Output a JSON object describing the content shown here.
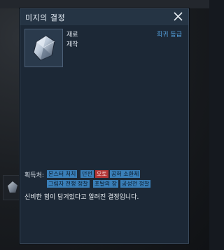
{
  "tooltip": {
    "title": "미지의 결정",
    "close_icon": "close-icon",
    "item_icon": "crystal-icon",
    "category1": "재료",
    "category2": "제작",
    "grade": "희귀 등급",
    "source_label": "획득처:",
    "sources": [
      "몬스터 처치",
      "던전",
      "오토",
      "공허 소환체",
      "그림자 전쟁 정찰",
      "포탈의 장",
      "공성전 정찰"
    ],
    "description": "신비한 힘이 담겨있다고 알려진 결정입니다."
  },
  "colors": {
    "grade": "#58a8e8",
    "tag": "#3a7fb8",
    "tag_alt": "#b23636"
  }
}
